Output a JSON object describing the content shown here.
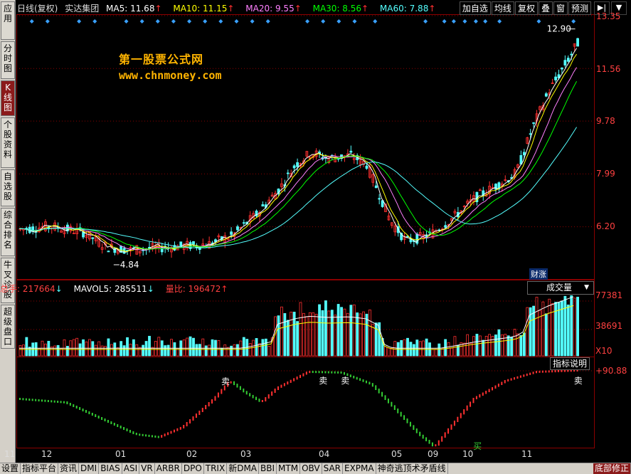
{
  "sidebar": {
    "tabs": [
      {
        "label": "应用",
        "active": false
      },
      {
        "label": "分时图",
        "active": false
      },
      {
        "label": "K线图",
        "active": true
      },
      {
        "label": "个股资料",
        "active": false
      },
      {
        "label": "自选股",
        "active": false
      },
      {
        "label": "综合排名",
        "active": false
      },
      {
        "label": "牛叉诊股",
        "active": false
      },
      {
        "label": "超级盘口",
        "active": false
      }
    ]
  },
  "header": {
    "period": "日线(复权)",
    "stock": "实达集团",
    "ma5": "MA5: 11.68",
    "ma10": "MA10: 11.15",
    "ma20": "MA20: 9.55",
    "ma30": "MA30: 8.56",
    "ma60": "MA60: 7.88",
    "up_arrow": "↑"
  },
  "colors": {
    "ma5": "#ffffff",
    "ma10": "#ffff00",
    "ma20": "#ff80ff",
    "ma30": "#00ff00",
    "ma60": "#54ffff",
    "up": "#ff3030",
    "down": "#54ffff",
    "axis": "#8b0000"
  },
  "toolbar": {
    "buttons": [
      "加自选",
      "均线",
      "复权",
      "叠",
      "窗",
      "预测"
    ],
    "nav_icons": [
      "skip-end-icon",
      "dropdown-icon"
    ]
  },
  "watermark": {
    "line1": "第一股票公式网",
    "line2": "www.chnmoney.com"
  },
  "price_axis": [
    "13.35",
    "11.56",
    "9.78",
    "7.99",
    "6.20"
  ],
  "annotations": {
    "high": "12.90",
    "low": "4.84",
    "caibao": "财涨"
  },
  "volume_panel": {
    "total_label": "总手: 217664",
    "mavol5_label": "MAVOL5: 285511",
    "ratio_label": "量比: 196472",
    "selector": "成交量",
    "axis": [
      "77381",
      "38691",
      "X10"
    ]
  },
  "indicator_panel": {
    "button": "指标说明",
    "axis_top": "+90.88",
    "signals": [
      {
        "label": "卖",
        "kind": "sell"
      },
      {
        "label": "卖",
        "kind": "sell"
      },
      {
        "label": "卖",
        "kind": "sell"
      },
      {
        "label": "卖",
        "kind": "sell"
      },
      {
        "label": "买",
        "kind": "buy"
      }
    ]
  },
  "date_axis": [
    "11",
    "12",
    "01",
    "02",
    "03",
    "04",
    "05",
    "09",
    "10",
    "11"
  ],
  "bottom_tabs": [
    "设置",
    "指标平台",
    "资讯",
    "DMI",
    "BIAS",
    "ASI",
    "VR",
    "ARBR",
    "DPO",
    "TRIX",
    "新DMA",
    "BBI",
    "MTM",
    "OBV",
    "SAR",
    "EXPMA",
    "神奇逃顶术矛盾线",
    "底部修正"
  ],
  "chart_data": {
    "type": "candlestick",
    "ylim": [
      4.84,
      13.35
    ],
    "price_ticks": [
      13.35,
      11.56,
      9.78,
      7.99,
      6.2
    ],
    "high": 12.9,
    "low": 4.84,
    "volume_ticks": [
      77381,
      38691
    ],
    "volume_unit": "X10",
    "indicator_top": 90.88
  }
}
